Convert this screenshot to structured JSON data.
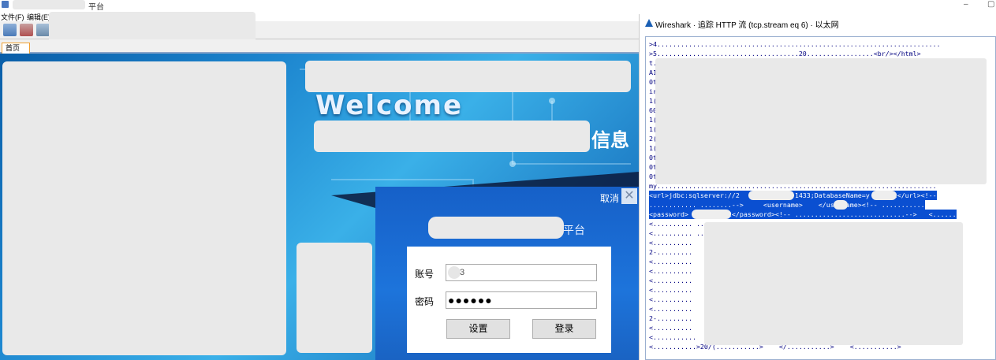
{
  "app": {
    "title_suffix": "平台",
    "menu": [
      "文件(F)",
      "编辑(E)"
    ],
    "tab_home": "首页",
    "window_controls": [
      "–",
      "▢"
    ]
  },
  "banner": {
    "welcome": "Welcome",
    "info_fragment": "信息"
  },
  "login": {
    "cancel_label": "取消",
    "close_glyph": "✕",
    "platform_suffix": "平台",
    "account_label": "账号",
    "account_value": "3",
    "password_label": "密码",
    "password_mask": "●●●●●●",
    "settings_button": "设置",
    "login_button": "登录"
  },
  "wireshark": {
    "title": "Wireshark · 追踪 HTTP 流 (tcp.stream eq 6) · 以太网",
    "lines": [
      ">4........................................................................",
      ">5....................................20.................<br/></html>",
      "t.                                                                    00",
      "A1                                                                    pt",
      "0t                                                                    t.",
      "ir                                                                    t:",
      "1(                                                                    ed",
      "60                                                                    :",
      "1(",
      "1(                                                                    fo",
      "2(                                                                    ow",
      "1(                                                                    01",
      "0t                                                                    4t",
      "0t",
      "0t                                                                    pr",
      "my.......................................................................",
      "<url>jdbc:sqlserver://2          200:1433;DatabaseName=y      2</url><!--",
      "............ ........-->     <username>    </username><!-- ...........",
      "<password>        002</password><!-- ............................-->   <......",
      "<.......... ........                                                  .......>",
      "<.......... ........                                            </.......",
      "<..........",
      "2-.........                                                           .....",
      "<..........                                                           .......",
      "<..........",
      "<..........                                                           .....",
      "<..........                                                           .......>",
      "<..........                                                           .....",
      "<..........",
      "2-.........                                                           ......",
      "<..........                                                           .....",
      "<...........                                                          .......",
      "<...........>20/(...........>    </...........>    <...........>"
    ],
    "highlight_rows": [
      16,
      17,
      18
    ]
  }
}
